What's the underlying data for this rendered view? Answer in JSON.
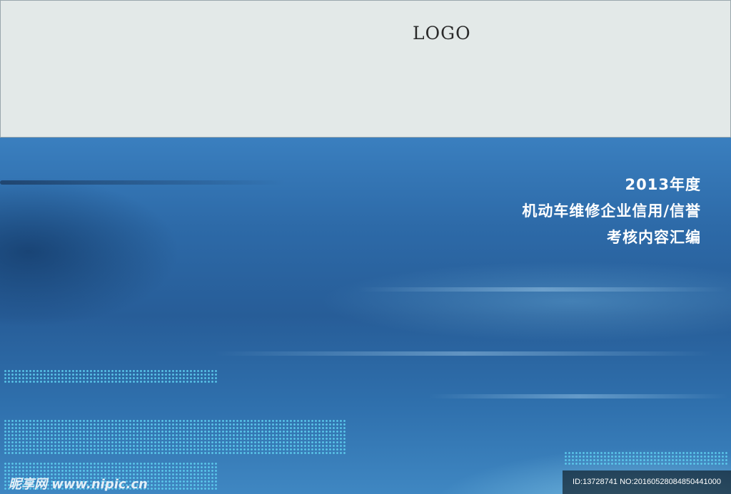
{
  "header": {
    "logo_text": "LOGO"
  },
  "cover": {
    "title_line1": "2013年度",
    "title_line2": "机动车维修企业信用/信誉",
    "title_line3": "考核内容汇编"
  },
  "watermark": {
    "site": "昵享网 www.nipic.cn",
    "id_text": "ID:13728741 NO:20160528084850441000"
  },
  "colors": {
    "top_panel": "#e3e9e8",
    "cover_blue": "#2d6aa8",
    "dot_cyan": "#5fd0f0",
    "title_text": "#ffffff"
  }
}
